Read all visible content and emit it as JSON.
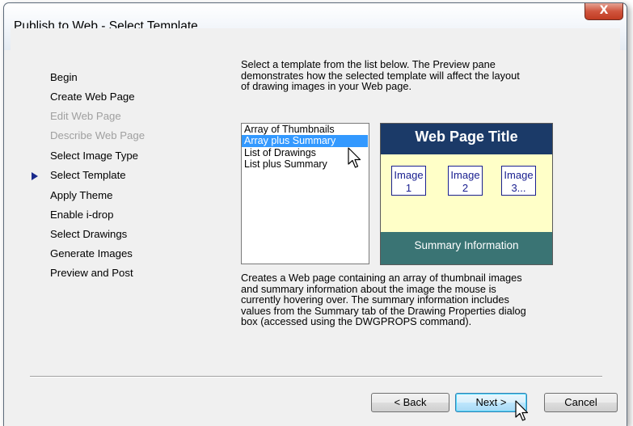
{
  "window": {
    "title": "Publish to Web - Select Template",
    "close_label": "X"
  },
  "steps": [
    {
      "label": "Begin",
      "enabled": true
    },
    {
      "label": "Create Web Page",
      "enabled": true
    },
    {
      "label": "Edit Web Page",
      "enabled": false
    },
    {
      "label": "Describe Web Page",
      "enabled": false
    },
    {
      "label": "Select Image Type",
      "enabled": true
    },
    {
      "label": "Select Template",
      "enabled": true,
      "current": true
    },
    {
      "label": "Apply Theme",
      "enabled": true
    },
    {
      "label": "Enable i-drop",
      "enabled": true
    },
    {
      "label": "Select Drawings",
      "enabled": true
    },
    {
      "label": "Generate Images",
      "enabled": true
    },
    {
      "label": "Preview and Post",
      "enabled": true
    }
  ],
  "instructions": {
    "line1": "Select a template from the list below.  The Preview pane",
    "line2": "demonstrates how the selected template will affect the layout",
    "line3": "of drawing images in your Web page."
  },
  "templates": {
    "items": [
      "Array of Thumbnails",
      "Array plus Summary",
      "List of Drawings",
      "List plus Summary"
    ],
    "selected": "Array plus Summary"
  },
  "preview": {
    "title": "Web Page Title",
    "thumbs": [
      {
        "line1": "Image",
        "line2": "1"
      },
      {
        "line1": "Image",
        "line2": "2"
      },
      {
        "line1": "Image",
        "line2": "3..."
      }
    ],
    "footer": "Summary Information"
  },
  "description": {
    "line1": "Creates a Web page containing an array of thumbnail images",
    "line2": "and summary information about the image the mouse is",
    "line3": "currently hovering over.  The summary information includes",
    "line4": "values from the Summary tab of the Drawing Properties dialog",
    "line5": "box (accessed using the DWGPROPS command)."
  },
  "buttons": {
    "back": "< Back",
    "next": "Next >",
    "cancel": "Cancel"
  },
  "icons": {
    "current_step": "arrow-right-icon",
    "cursor": "mouse-pointer-icon"
  },
  "colors": {
    "selection": "#3399ff",
    "preview_title_bg": "#1b3a68",
    "preview_body_bg": "#ffffc8",
    "preview_footer_bg": "#3a7474",
    "step_marker": "#1a2a8c"
  }
}
